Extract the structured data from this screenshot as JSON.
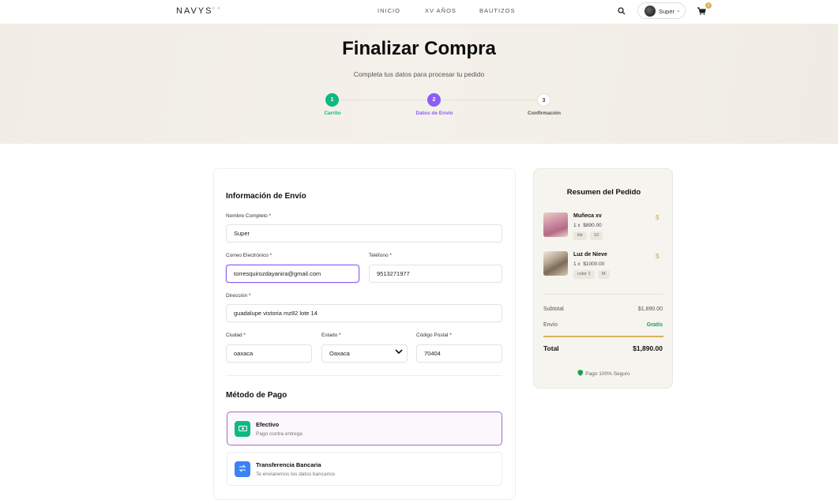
{
  "header": {
    "logo": "NAVYS",
    "logo_sub": "ª ª",
    "nav": [
      "INICIO",
      "XV AÑOS",
      "BAUTIZOS"
    ],
    "user_name": "Super",
    "cart_count": "1"
  },
  "hero": {
    "title": "Finalizar Compra",
    "subtitle": "Completa tus datos para procesar tu pedido",
    "steps": [
      {
        "number": "1",
        "label": "Carrito"
      },
      {
        "number": "2",
        "label": "Datos de Envío"
      },
      {
        "number": "3",
        "label": "Confirmación"
      }
    ]
  },
  "shipping": {
    "title": "Información de Envío",
    "name_label": "Nombre Completo *",
    "name_value": "Super",
    "email_label": "Correo Electrónico *",
    "email_value": "torresquirozdayanira@gmail.com",
    "phone_label": "Teléfono *",
    "phone_value": "9513271977",
    "address_label": "Dirección *",
    "address_value": "guadalupe vistoria mz82 lote 14",
    "city_label": "Ciudad *",
    "city_value": "oaxaca",
    "state_label": "Estado *",
    "state_value": "Oaxaca",
    "zip_label": "Código Postal *",
    "zip_value": "70404"
  },
  "payment": {
    "title": "Método de Pago",
    "options": [
      {
        "title": "Efectivo",
        "desc": "Pago contra entrega",
        "selected": true
      },
      {
        "title": "Transferencia Bancaria",
        "desc": "Te enviaremos los datos bancarios",
        "selected": false
      }
    ]
  },
  "summary": {
    "title": "Resumen del Pedido",
    "items": [
      {
        "name": "Muñeca xv",
        "qty": "1 x",
        "price": "$890.00",
        "tags": [
          "lile",
          "10"
        ],
        "price_symbol": "$"
      },
      {
        "name": "Luz de Nieve",
        "qty": "1 x",
        "price": "$1000.00",
        "tags": [
          "color 1",
          "M"
        ],
        "price_symbol": "$"
      }
    ],
    "subtotal_label": "Subtotal",
    "subtotal_value": "$1,890.00",
    "shipping_label": "Envío",
    "shipping_value": "Gratis",
    "total_label": "Total",
    "total_value": "$1,890.00",
    "secure_text": "Pago 100% Seguro"
  },
  "colors": {
    "accent_purple": "#8b5cf6",
    "success_green": "#10b981",
    "gold": "#d8b45a",
    "transfer_blue": "#3b82f6"
  }
}
